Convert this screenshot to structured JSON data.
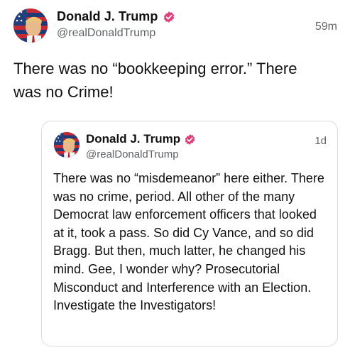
{
  "post": {
    "author_name": "Donald J. Trump",
    "handle": "@realDonaldTrump",
    "time": "59m",
    "text": "There was no “bookkeeping error.” There was no Crime!"
  },
  "quoted_post": {
    "author_name": "Donald J. Trump",
    "handle": "@realDonaldTrump",
    "time": "1d",
    "text": "There was no “misdemeanor” here either. There was no crime, period. All other of the many Democrat law enforcement officers that looked at it, took a pass. So did Cy Vance, and so did Bragg. But then, much latter, he changed his mind. Gee, I wonder why? Prosecutorial Misconduct and Interference with an Election. Investigate the Investigators!"
  },
  "colors": {
    "verified_badge": "#e0407a",
    "handle_gray": "#5f6368",
    "card_border": "#dcdcdc"
  },
  "icons": {
    "avatar": "avatar-flag-portrait",
    "verified": "verified-badge-icon"
  }
}
